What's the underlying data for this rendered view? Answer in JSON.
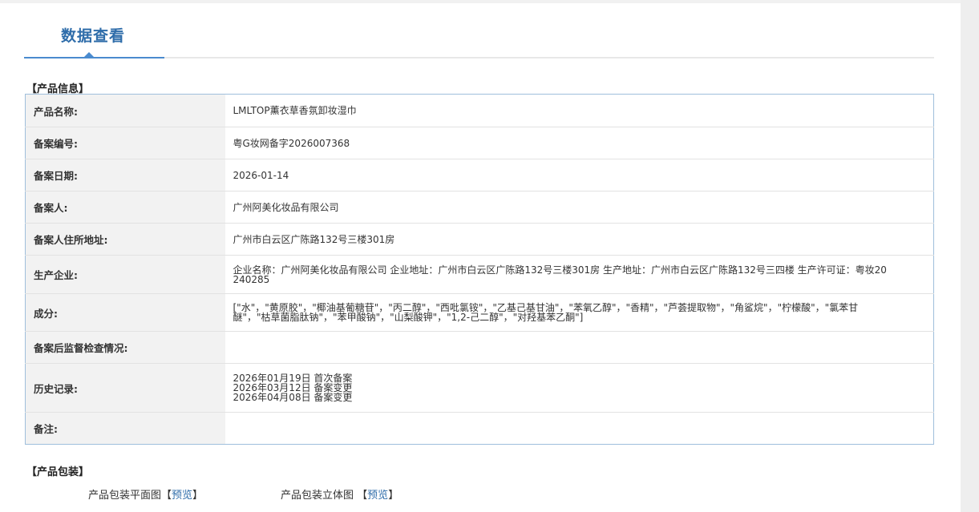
{
  "page": {
    "tab_title": "数据查看"
  },
  "product_info": {
    "section_title": "【产品信息】",
    "rows": [
      {
        "label": "产品名称:",
        "value": "LMLTOP薰衣草香氛卸妆湿巾"
      },
      {
        "label": "备案编号:",
        "value": "粤G妆网备字2026007368"
      },
      {
        "label": "备案日期:",
        "value": "2026-01-14"
      },
      {
        "label": "备案人:",
        "value": "广州阿美化妆品有限公司"
      },
      {
        "label": "备案人住所地址:",
        "value": "广州市白云区广陈路132号三楼301房"
      },
      {
        "label": "生产企业:",
        "value": "企业名称：广州阿美化妆品有限公司 企业地址：广州市白云区广陈路132号三楼301房 生产地址：广州市白云区广陈路132号三四楼 生产许可证：粤妆20240285"
      },
      {
        "label": "成分:",
        "value": "[\"水\"，\"黄原胶\"，\"椰油基葡糖苷\"，\"丙二醇\"，\"西吡氯铵\"，\"乙基己基甘油\"，\"苯氧乙醇\"，\"香精\"，\"芦荟提取物\"，\"角鲨烷\"，\"柠檬酸\"，\"氯苯甘醚\"，\"枯草菌脂肽钠\"，\"苯甲酸钠\"，\"山梨酸钾\"，\"1,2-己二醇\"，\"对羟基苯乙酮\"]"
      },
      {
        "label": "备案后监督检查情况:",
        "value": ""
      },
      {
        "label": "历史记录:",
        "history": [
          "2026年01月19日 首次备案",
          "2026年03月12日 备案变更",
          "2026年04月08日 备案变更"
        ]
      },
      {
        "label": "备注:",
        "value": ""
      }
    ]
  },
  "packaging": {
    "section_title": "【产品包装】",
    "flat": {
      "label": "产品包装平面图",
      "open": "【",
      "link": "预览",
      "close": "】"
    },
    "stereo": {
      "label": "产品包装立体图",
      "open": "【",
      "link": "预览",
      "close": "】"
    }
  }
}
